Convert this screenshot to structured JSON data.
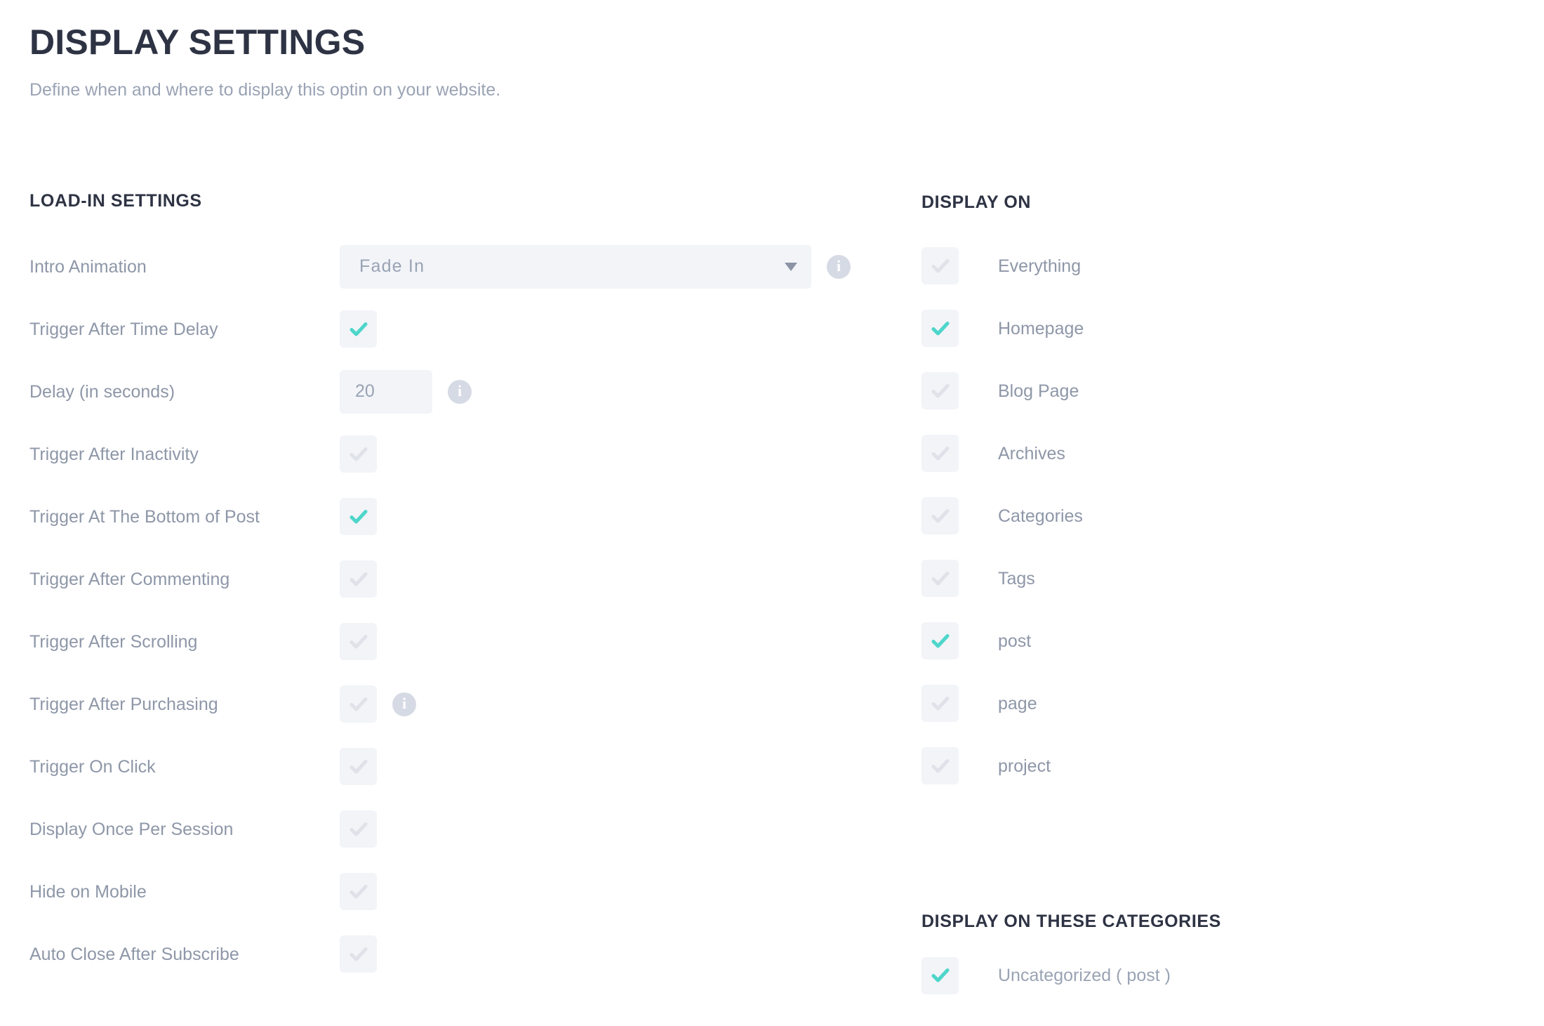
{
  "header": {
    "title": "DISPLAY SETTINGS",
    "subtitle": "Define when and where to display this optin on your website."
  },
  "colors": {
    "accent_checked": "#4ed6ca",
    "checkbox_bg": "#f2f4f8",
    "checkbox_unchecked_tick": "#dfe2e8",
    "heading": "#2e3344",
    "label": "#8e97a8",
    "info_icon_bg": "#d6dae4"
  },
  "load_in_settings": {
    "title": "LOAD-IN SETTINGS",
    "rows": [
      {
        "label": "Intro Animation",
        "control": "select",
        "value": "Fade In",
        "caret_icon": "chevron-down-icon",
        "info": true,
        "info_icon": "info-icon"
      },
      {
        "label": "Trigger After Time Delay",
        "control": "checkbox",
        "checked": true,
        "info": false
      },
      {
        "label": "Delay (in seconds)",
        "control": "text",
        "value": "20",
        "placeholder": "",
        "info": true,
        "info_icon": "info-icon"
      },
      {
        "label": "Trigger After Inactivity",
        "control": "checkbox",
        "checked": false,
        "info": false
      },
      {
        "label": "Trigger At The Bottom of Post",
        "control": "checkbox",
        "checked": true,
        "info": false
      },
      {
        "label": "Trigger After Commenting",
        "control": "checkbox",
        "checked": false,
        "info": false
      },
      {
        "label": "Trigger After Scrolling",
        "control": "checkbox",
        "checked": false,
        "info": false
      },
      {
        "label": "Trigger After Purchasing",
        "control": "checkbox",
        "checked": false,
        "info": true,
        "info_icon": "info-icon"
      },
      {
        "label": "Trigger On Click",
        "control": "checkbox",
        "checked": false,
        "info": false
      },
      {
        "label": "Display Once Per Session",
        "control": "checkbox",
        "checked": false,
        "info": false
      },
      {
        "label": "Hide on Mobile",
        "control": "checkbox",
        "checked": false,
        "info": false
      },
      {
        "label": "Auto Close After Subscribe",
        "control": "checkbox",
        "checked": false,
        "info": false
      }
    ]
  },
  "display_on": {
    "title": "DISPLAY ON",
    "rows": [
      {
        "label": "Everything",
        "checked": false
      },
      {
        "label": "Homepage",
        "checked": true
      },
      {
        "label": "Blog Page",
        "checked": false
      },
      {
        "label": "Archives",
        "checked": false
      },
      {
        "label": "Categories",
        "checked": false
      },
      {
        "label": "Tags",
        "checked": false
      },
      {
        "label": "post",
        "checked": true
      },
      {
        "label": "page",
        "checked": false
      },
      {
        "label": "project",
        "checked": false
      }
    ]
  },
  "display_on_categories": {
    "title": "DISPLAY ON THESE CATEGORIES",
    "rows": [
      {
        "label": "Uncategorized ( post )",
        "checked": true
      }
    ]
  }
}
